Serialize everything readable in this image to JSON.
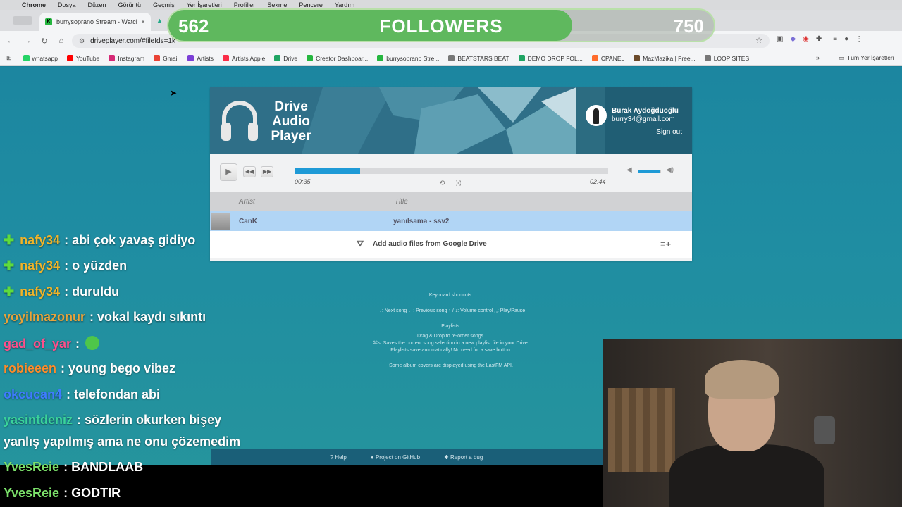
{
  "menubar": {
    "items": [
      "Chrome",
      "Dosya",
      "Düzen",
      "Görüntü",
      "Geçmiş",
      "Yer İşaretleri",
      "Profiller",
      "Sekme",
      "Pencere",
      "Yardım"
    ]
  },
  "tabs": {
    "active_label": "burrysoprano Stream - Watch"
  },
  "address": {
    "url": "driveplayer.com/#fileIds=1k"
  },
  "bookmarks": {
    "items": [
      {
        "label": "whatsapp",
        "color": "#25d366"
      },
      {
        "label": "YouTube",
        "color": "#ff0000"
      },
      {
        "label": "Instagram",
        "color": "#d62976"
      },
      {
        "label": "Gmail",
        "color": "#ea4335"
      },
      {
        "label": "Artists",
        "color": "#7b3fd6"
      },
      {
        "label": "Artists Apple",
        "color": "#fa2d48"
      },
      {
        "label": "Drive",
        "color": "#1fa463"
      },
      {
        "label": "Creator Dashboar...",
        "color": "#25b63f"
      },
      {
        "label": "burrysoprano Stre...",
        "color": "#25b63f"
      },
      {
        "label": "BEATSTARS BEAT",
        "color": "#777777"
      },
      {
        "label": "DEMO DROP FOL...",
        "color": "#1fa463"
      },
      {
        "label": "CPANEL",
        "color": "#ff6c2c"
      },
      {
        "label": "MazMazika | Free...",
        "color": "#6b4a2a"
      },
      {
        "label": "LOOP SITES",
        "color": "#777777"
      }
    ],
    "all_label": "Tüm Yer İşaretleri"
  },
  "player": {
    "logo_lines": [
      "Drive",
      "Audio",
      "Player"
    ],
    "user_name": "Burak Aydoğduoğlu",
    "user_email": "burry34@gmail.com",
    "sign_out": "Sign out",
    "current_time": "00:35",
    "total_time": "02:44",
    "progress_fraction": 0.21,
    "volume_fraction": 0.95,
    "col_artist": "Artist",
    "col_title": "Title",
    "track_artist": "CanK",
    "track_title": "yanılsama - ssv2",
    "add_label": "Add audio files from Google Drive"
  },
  "help": {
    "shortcuts_title": "Keyboard shortcuts:",
    "shortcuts_text": "→: Next song  ←: Previous song  ↑ / ↓: Volume control  ␣: Play/Pause",
    "playlists_title": "Playlists:",
    "playlists_line1": "Drag & Drop to re-order songs.",
    "playlists_line2": "⌘s: Saves the current song selection in a new playlist file in your Drive.",
    "playlists_line3": "Playlists save automatically! No need for a save button.",
    "lastfm": "Some album covers are displayed using the LastFM API."
  },
  "footer": {
    "help": "Help",
    "github": "Project on GitHub",
    "bug": "Report a bug"
  },
  "followers": {
    "current": "562",
    "label": "FOLLOWERS",
    "goal": "750",
    "fill_fraction": 0.74
  },
  "chat": [
    {
      "user": "nafy34",
      "text": ": abi çok yavaş gidiyo",
      "color": "#f0b429",
      "badge": true
    },
    {
      "user": "nafy34",
      "text": ": o yüzden",
      "color": "#f0b429",
      "badge": true
    },
    {
      "user": "nafy34",
      "text": ": duruldu",
      "color": "#f0b429",
      "badge": true
    },
    {
      "user": "yoyilmazonur",
      "text": ": vokal kaydı sıkıntı",
      "color": "#e8a33a",
      "badge": false
    },
    {
      "user": "gad_of_yar",
      "text": ":",
      "color": "#ff4f8b",
      "badge": false,
      "emote": true
    },
    {
      "user": "robieeen",
      "text": ": young bego vibez",
      "color": "#ff8c2a",
      "badge": false
    },
    {
      "user": "okcucan4",
      "text": ": telefondan abi",
      "color": "#3f7bff",
      "badge": false
    },
    {
      "user": "yasintdeniz",
      "text": ": sözlerin okurken bişey",
      "color": "#3ad39a",
      "badge": false
    },
    {
      "user": "",
      "text": "yanlış yapılmış ama ne onu çözemedim",
      "color": "#ffffff",
      "badge": false
    },
    {
      "user": "YvesReie",
      "text": ": BANDLAAB",
      "color": "#7be06a",
      "badge": false
    },
    {
      "user": "YvesReie",
      "text": ": GODTIR",
      "color": "#7be06a",
      "badge": false
    }
  ]
}
